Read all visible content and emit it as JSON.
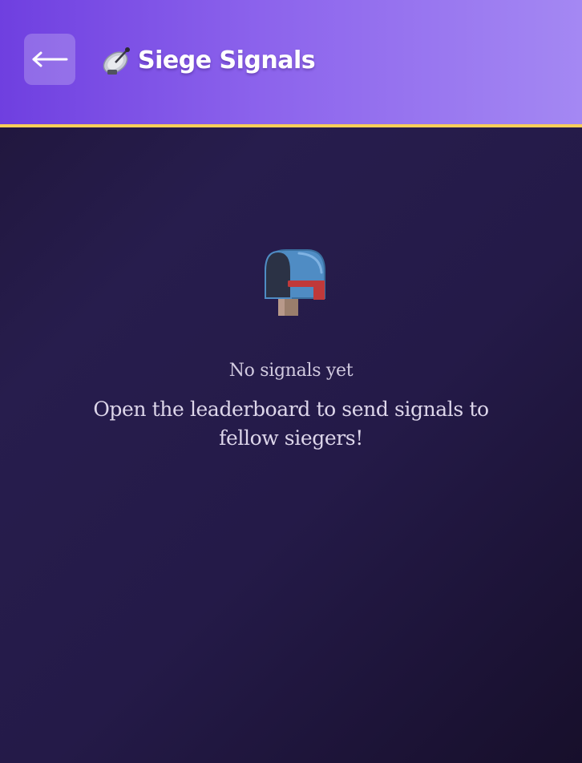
{
  "header": {
    "back_label": "←",
    "title": "Siege Signals",
    "title_icon": "satellite-dish-icon",
    "accent_border_color": "#f8cf58"
  },
  "empty_state": {
    "icon": "open-mailbox-icon",
    "title": "No signals yet",
    "message": "Open the leaderboard to send signals to fellow siegers!"
  }
}
